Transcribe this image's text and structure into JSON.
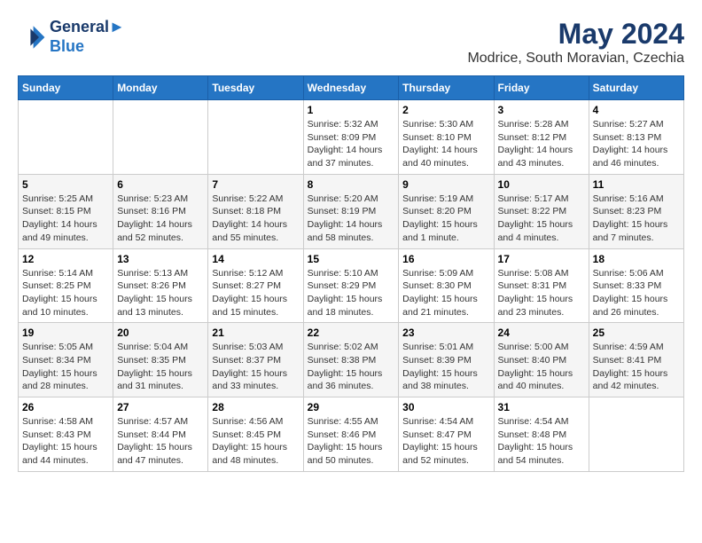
{
  "header": {
    "logo_line1": "General",
    "logo_line2": "Blue",
    "month": "May 2024",
    "location": "Modrice, South Moravian, Czechia"
  },
  "weekdays": [
    "Sunday",
    "Monday",
    "Tuesday",
    "Wednesday",
    "Thursday",
    "Friday",
    "Saturday"
  ],
  "weeks": [
    [
      {
        "day": "",
        "info": ""
      },
      {
        "day": "",
        "info": ""
      },
      {
        "day": "",
        "info": ""
      },
      {
        "day": "1",
        "info": "Sunrise: 5:32 AM\nSunset: 8:09 PM\nDaylight: 14 hours\nand 37 minutes."
      },
      {
        "day": "2",
        "info": "Sunrise: 5:30 AM\nSunset: 8:10 PM\nDaylight: 14 hours\nand 40 minutes."
      },
      {
        "day": "3",
        "info": "Sunrise: 5:28 AM\nSunset: 8:12 PM\nDaylight: 14 hours\nand 43 minutes."
      },
      {
        "day": "4",
        "info": "Sunrise: 5:27 AM\nSunset: 8:13 PM\nDaylight: 14 hours\nand 46 minutes."
      }
    ],
    [
      {
        "day": "5",
        "info": "Sunrise: 5:25 AM\nSunset: 8:15 PM\nDaylight: 14 hours\nand 49 minutes."
      },
      {
        "day": "6",
        "info": "Sunrise: 5:23 AM\nSunset: 8:16 PM\nDaylight: 14 hours\nand 52 minutes."
      },
      {
        "day": "7",
        "info": "Sunrise: 5:22 AM\nSunset: 8:18 PM\nDaylight: 14 hours\nand 55 minutes."
      },
      {
        "day": "8",
        "info": "Sunrise: 5:20 AM\nSunset: 8:19 PM\nDaylight: 14 hours\nand 58 minutes."
      },
      {
        "day": "9",
        "info": "Sunrise: 5:19 AM\nSunset: 8:20 PM\nDaylight: 15 hours\nand 1 minute."
      },
      {
        "day": "10",
        "info": "Sunrise: 5:17 AM\nSunset: 8:22 PM\nDaylight: 15 hours\nand 4 minutes."
      },
      {
        "day": "11",
        "info": "Sunrise: 5:16 AM\nSunset: 8:23 PM\nDaylight: 15 hours\nand 7 minutes."
      }
    ],
    [
      {
        "day": "12",
        "info": "Sunrise: 5:14 AM\nSunset: 8:25 PM\nDaylight: 15 hours\nand 10 minutes."
      },
      {
        "day": "13",
        "info": "Sunrise: 5:13 AM\nSunset: 8:26 PM\nDaylight: 15 hours\nand 13 minutes."
      },
      {
        "day": "14",
        "info": "Sunrise: 5:12 AM\nSunset: 8:27 PM\nDaylight: 15 hours\nand 15 minutes."
      },
      {
        "day": "15",
        "info": "Sunrise: 5:10 AM\nSunset: 8:29 PM\nDaylight: 15 hours\nand 18 minutes."
      },
      {
        "day": "16",
        "info": "Sunrise: 5:09 AM\nSunset: 8:30 PM\nDaylight: 15 hours\nand 21 minutes."
      },
      {
        "day": "17",
        "info": "Sunrise: 5:08 AM\nSunset: 8:31 PM\nDaylight: 15 hours\nand 23 minutes."
      },
      {
        "day": "18",
        "info": "Sunrise: 5:06 AM\nSunset: 8:33 PM\nDaylight: 15 hours\nand 26 minutes."
      }
    ],
    [
      {
        "day": "19",
        "info": "Sunrise: 5:05 AM\nSunset: 8:34 PM\nDaylight: 15 hours\nand 28 minutes."
      },
      {
        "day": "20",
        "info": "Sunrise: 5:04 AM\nSunset: 8:35 PM\nDaylight: 15 hours\nand 31 minutes."
      },
      {
        "day": "21",
        "info": "Sunrise: 5:03 AM\nSunset: 8:37 PM\nDaylight: 15 hours\nand 33 minutes."
      },
      {
        "day": "22",
        "info": "Sunrise: 5:02 AM\nSunset: 8:38 PM\nDaylight: 15 hours\nand 36 minutes."
      },
      {
        "day": "23",
        "info": "Sunrise: 5:01 AM\nSunset: 8:39 PM\nDaylight: 15 hours\nand 38 minutes."
      },
      {
        "day": "24",
        "info": "Sunrise: 5:00 AM\nSunset: 8:40 PM\nDaylight: 15 hours\nand 40 minutes."
      },
      {
        "day": "25",
        "info": "Sunrise: 4:59 AM\nSunset: 8:41 PM\nDaylight: 15 hours\nand 42 minutes."
      }
    ],
    [
      {
        "day": "26",
        "info": "Sunrise: 4:58 AM\nSunset: 8:43 PM\nDaylight: 15 hours\nand 44 minutes."
      },
      {
        "day": "27",
        "info": "Sunrise: 4:57 AM\nSunset: 8:44 PM\nDaylight: 15 hours\nand 47 minutes."
      },
      {
        "day": "28",
        "info": "Sunrise: 4:56 AM\nSunset: 8:45 PM\nDaylight: 15 hours\nand 48 minutes."
      },
      {
        "day": "29",
        "info": "Sunrise: 4:55 AM\nSunset: 8:46 PM\nDaylight: 15 hours\nand 50 minutes."
      },
      {
        "day": "30",
        "info": "Sunrise: 4:54 AM\nSunset: 8:47 PM\nDaylight: 15 hours\nand 52 minutes."
      },
      {
        "day": "31",
        "info": "Sunrise: 4:54 AM\nSunset: 8:48 PM\nDaylight: 15 hours\nand 54 minutes."
      },
      {
        "day": "",
        "info": ""
      }
    ]
  ]
}
